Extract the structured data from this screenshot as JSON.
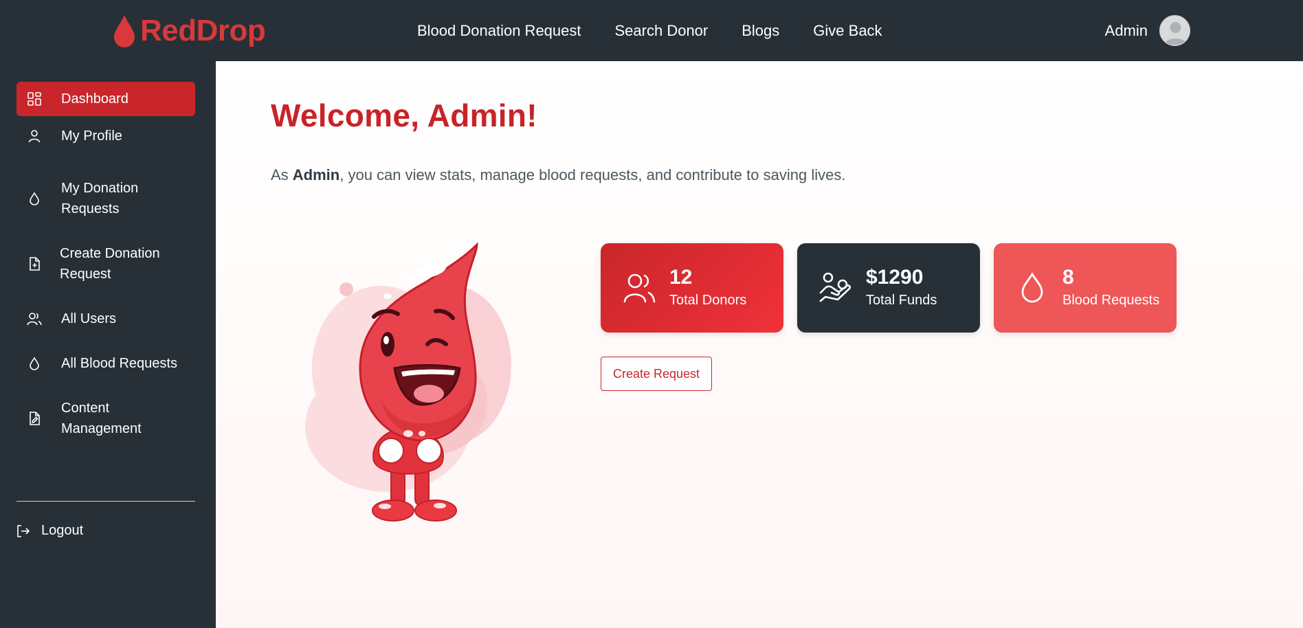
{
  "brand": {
    "name": "RedDrop",
    "color": "#d8393b"
  },
  "nav": {
    "links": [
      "Blood Donation Request",
      "Search Donor",
      "Blogs",
      "Give Back"
    ],
    "user_name": "Admin"
  },
  "sidebar": {
    "items": [
      {
        "label": "Dashboard",
        "icon": "dashboard-icon",
        "active": true
      },
      {
        "label": "My Profile",
        "icon": "user-icon"
      },
      {
        "label": "My Donation Requests",
        "icon": "droplet-icon"
      },
      {
        "label": "Create Donation Request",
        "icon": "file-plus-icon"
      },
      {
        "label": "All Users",
        "icon": "users-icon"
      },
      {
        "label": "All Blood Requests",
        "icon": "droplet-icon"
      },
      {
        "label": "Content Management",
        "icon": "file-edit-icon"
      }
    ],
    "logout_label": "Logout"
  },
  "main": {
    "welcome": "Welcome, Admin!",
    "intro_prefix": "As ",
    "intro_name": "Admin",
    "intro_suffix": ", you can view stats, manage blood requests, and contribute to saving lives.",
    "stats": [
      {
        "value": "12",
        "label": "Total Donors",
        "icon": "users-icon"
      },
      {
        "value": "$1290",
        "label": "Total Funds",
        "icon": "hand-coins-icon"
      },
      {
        "value": "8",
        "label": "Blood Requests",
        "icon": "droplet-icon"
      }
    ],
    "create_button": "Create Request"
  },
  "colors": {
    "dark": "#273037",
    "accent_red": "#c9262b",
    "coral": "#ee5657"
  }
}
